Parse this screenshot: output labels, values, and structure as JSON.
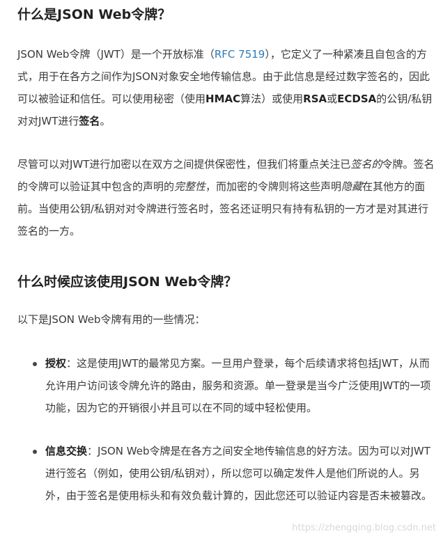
{
  "section1": {
    "heading": "什么是JSON Web令牌？",
    "para1": {
      "t1": "JSON Web令牌（JWT）是一个开放标准（",
      "link": "RFC 7519",
      "t2": "），它定义了一种紧凑且自包含的方式，用于在各方之间作为JSON对象安全地传输信息。由于此信息是经过数字签名的，因此可以被验证和信任。可以使用秘密（使用",
      "b1": "HMAC",
      "t3": "算法）或使用",
      "b2": "RSA",
      "t4": "或",
      "b3": "ECDSA",
      "t5": "的公钥/私钥对对JWT进行",
      "b4": "签名",
      "t6": "。"
    },
    "para2": {
      "t1": "尽管可以对JWT进行加密以在双方之间提供保密性，但我们将重点关注已",
      "i1": "签名的",
      "t2": "令牌。签名的令牌可以验证其中包含的声明的",
      "i2": "完整性",
      "t3": "，而加密的令牌则将这些声明",
      "i3": "隐藏",
      "t4": "在其他方的面前。当使用公钥/私钥对对令牌进行签名时，签名还证明只有持有私钥的一方才是对其进行签名的一方。"
    }
  },
  "section2": {
    "heading": "什么时候应该使用JSON Web令牌？",
    "intro": "以下是JSON Web令牌有用的一些情况：",
    "items": [
      {
        "term": "授权",
        "text": "：这是使用JWT的最常见方案。一旦用户登录，每个后续请求将包括JWT，从而允许用户访问该令牌允许的路由，服务和资源。单一登录是当今广泛使用JWT的一项功能，因为它的开销很小并且可以在不同的域中轻松使用。"
      },
      {
        "term": "信息交换",
        "text": "：JSON Web令牌是在各方之间安全地传输信息的好方法。因为可以对JWT进行签名（例如，使用公钥/私钥对），所以您可以确定发件人是他们所说的人。另外，由于签名是使用标头和有效负载计算的，因此您还可以验证内容是否未被篡改。"
      }
    ]
  },
  "watermark": "https://zhengqing.blog.csdn.net",
  "colors": {
    "link": "#2b7bb9",
    "text": "#3a3a3a",
    "heading": "#222222"
  }
}
